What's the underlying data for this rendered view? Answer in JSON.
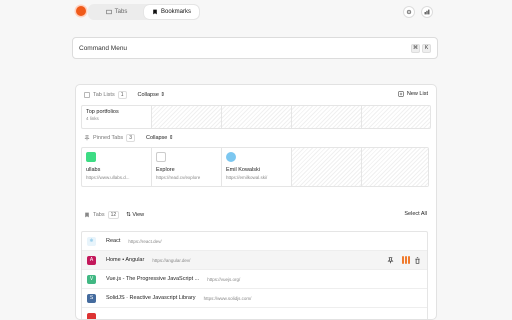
{
  "topbar": {
    "tabs": [
      {
        "label": "Tabs",
        "active": false
      },
      {
        "label": "Bookmarks",
        "active": true
      }
    ],
    "accent": "#f05a1a"
  },
  "command": {
    "label": "Command Menu",
    "keys": [
      "⌘",
      "K"
    ]
  },
  "tab_lists": {
    "heading": "Tab Lists",
    "count": "1",
    "collapse_label": "Collapse",
    "new_label": "New List",
    "lists": [
      {
        "title": "Top portfolios",
        "subtitle": "4 links"
      }
    ]
  },
  "pinned": {
    "heading": "Pinned Tabs",
    "count": "3",
    "collapse_label": "Collapse",
    "items": [
      {
        "title": "ullabs",
        "url": "https://www.ullabs.d...",
        "color": "#3ddc84",
        "icon": "ullabs-favicon"
      },
      {
        "title": "Explore",
        "url": "https://read.cv/explore",
        "color": "#ffffff",
        "icon": "readcv-favicon"
      },
      {
        "title": "Emil Kowalski",
        "url": "https://emilkowal.ski/",
        "color": "#7cc7f0",
        "icon": "emil-favicon"
      }
    ]
  },
  "tabs": {
    "heading": "Tabs",
    "count": "12",
    "view_label": "View",
    "select_all_label": "Select All",
    "items": [
      {
        "title": "React",
        "url": "https://react.dev/",
        "color": "#e8f4fb",
        "icon": "react-favicon",
        "glyph": "⚛"
      },
      {
        "title": "Home • Angular",
        "url": "https://angular.dev/",
        "color": "#c3185b",
        "icon": "angular-favicon",
        "glyph": "A"
      },
      {
        "title": "Vue.js - The Progressive JavaScript ...",
        "url": "https://vuejs.org/",
        "color": "#41b883",
        "icon": "vue-favicon",
        "glyph": "V"
      },
      {
        "title": "SolidJS · Reactive Javascript Library",
        "url": "https://www.solidjs.com/",
        "color": "#446b9e",
        "icon": "solid-favicon",
        "glyph": "S"
      }
    ]
  }
}
